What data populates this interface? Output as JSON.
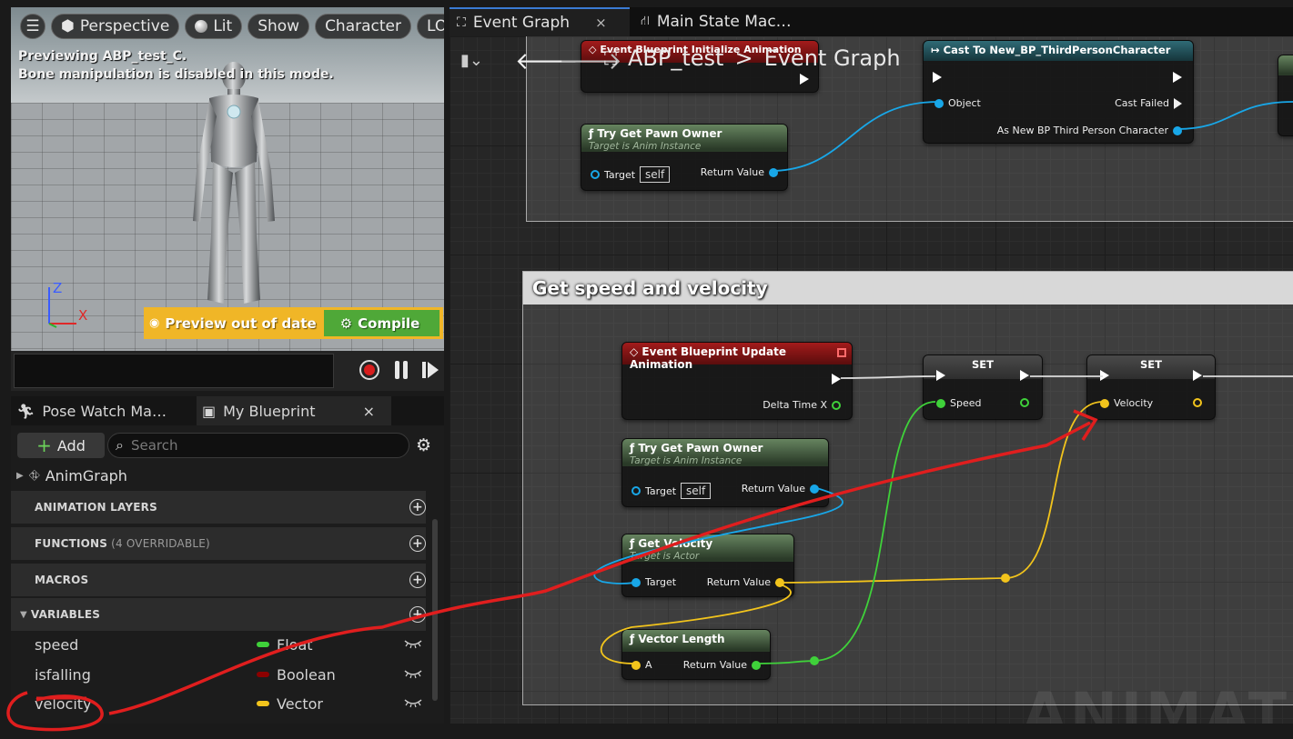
{
  "viewport": {
    "menu_icon": "hamburger-icon",
    "perspective_label": "Perspective",
    "lit_label": "Lit",
    "show_label": "Show",
    "character_label": "Character",
    "lod_label": "LOD",
    "message_line1": "Previewing ABP_test_C.",
    "message_line2": "Bone manipulation is disabled in this mode.",
    "axis_z": "Z",
    "axis_x": "X",
    "preview_label": "Preview out of date",
    "compile_label": "Compile"
  },
  "my_blueprint": {
    "tabs": [
      {
        "label": "Pose Watch Ma…"
      },
      {
        "label": "My Blueprint",
        "close": "×"
      }
    ],
    "add_label": "Add",
    "search_placeholder": "Search",
    "anim_graph_label": "AnimGraph",
    "sections": {
      "animation_layers": "ANIMATION LAYERS",
      "functions": "FUNCTIONS",
      "functions_sub": "(4 OVERRIDABLE)",
      "macros": "MACROS",
      "variables": "VARIABLES"
    },
    "variables": [
      {
        "name": "speed",
        "type": "Float",
        "color": "#3fd13a"
      },
      {
        "name": "isfalling",
        "type": "Boolean",
        "color": "#8c0000"
      },
      {
        "name": "velocity",
        "type": "Vector",
        "color": "#f2c41c"
      }
    ]
  },
  "graph_tabs": {
    "event_graph": "Event Graph",
    "close": "×",
    "state_machine": "Main State Mac…"
  },
  "graph": {
    "breadcrumb_root": "ABP_test",
    "breadcrumb_sep": ">",
    "breadcrumb_current": "Event Graph",
    "comment_title": "Get speed and velocity",
    "watermark": "ANIMATIC",
    "nodes": {
      "init_event": "Event Blueprint Initialize Animation",
      "try_get_pawn_1": {
        "title": "Try Get Pawn Owner",
        "sub": "Target is Anim Instance",
        "target": "Target",
        "self": "self",
        "ret": "Return Value"
      },
      "cast": {
        "title": "Cast To New_BP_ThirdPersonCharacter",
        "object": "Object",
        "failed": "Cast Failed",
        "as": "As New BP Third Person Character"
      },
      "update_event": {
        "title": "Event Blueprint Update Animation",
        "delta": "Delta Time X"
      },
      "try_get_pawn_2": {
        "title": "Try Get Pawn Owner",
        "sub": "Target is Anim Instance",
        "target": "Target",
        "self": "self",
        "ret": "Return Value"
      },
      "get_velocity": {
        "title": "Get Velocity",
        "sub": "Target is Actor",
        "target": "Target",
        "ret": "Return Value"
      },
      "vector_length": {
        "title": "Vector Length",
        "a": "A",
        "ret": "Return Value"
      },
      "set_speed": {
        "title": "SET",
        "pin": "Speed"
      },
      "set_velocity": {
        "title": "SET",
        "pin": "Velocity"
      }
    }
  },
  "colors": {
    "float_pin": "#3fd13a",
    "vector_pin": "#f2c41c",
    "object_pin": "#18a7e8",
    "annotation": "#e01e1e",
    "preview_bar": "#f0b627",
    "compile": "#4fa838"
  }
}
